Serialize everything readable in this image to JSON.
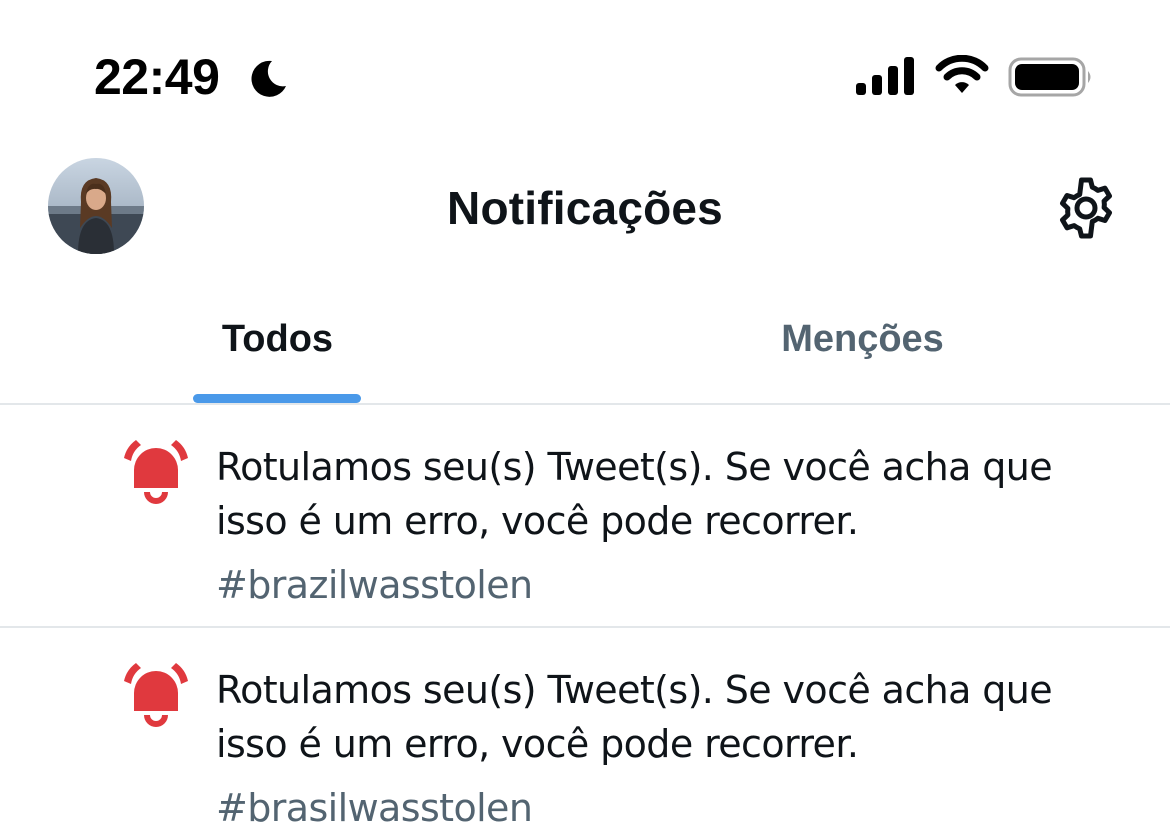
{
  "status_bar": {
    "time": "22:49",
    "icons": [
      "moon-icon",
      "cellular-signal-icon",
      "wifi-icon",
      "battery-icon"
    ]
  },
  "header": {
    "title": "Notificações",
    "avatar": "profile-avatar",
    "settings_icon": "gear-icon"
  },
  "tabs": [
    {
      "label": "Todos",
      "active": true
    },
    {
      "label": "Menções",
      "active": false
    }
  ],
  "notifications": [
    {
      "icon": "bell-icon",
      "line1": "Rotulamos seu(s) Tweet(s). Se você acha que",
      "line2": "isso é um erro, você pode recorrer.",
      "tag": "#brazilwasstolen"
    },
    {
      "icon": "bell-icon",
      "line1": "Rotulamos seu(s) Tweet(s). Se você acha que",
      "line2": "isso é um erro, você pode recorrer.",
      "tag": "#brasilwasstolen"
    }
  ],
  "colors": {
    "accent": "#4a99e9",
    "bell": "#e0393e",
    "text_primary": "#0f1419",
    "text_secondary": "#536471",
    "divider": "#e3e7ea"
  }
}
